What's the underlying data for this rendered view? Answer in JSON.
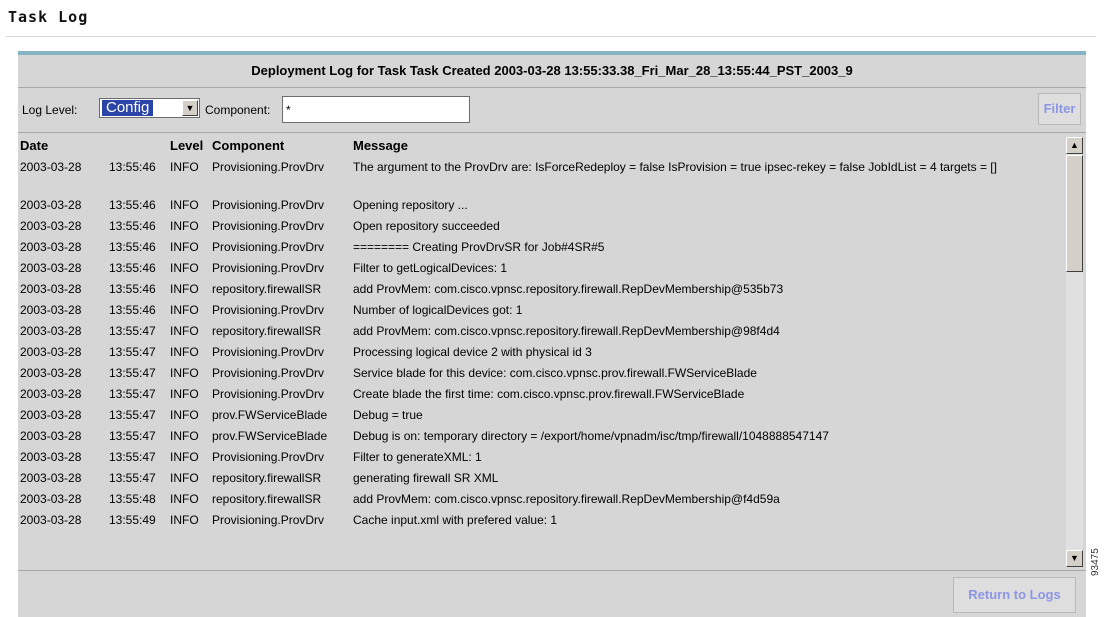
{
  "page": {
    "title": "Task Log"
  },
  "panel": {
    "header": "Deployment Log for Task Task Created 2003-03-28 13:55:33.38_Fri_Mar_28_13:55:44_PST_2003_9"
  },
  "controls": {
    "log_level_label": "Log Level:",
    "log_level_value": "Config",
    "component_label": "Component:",
    "component_value": "*",
    "filter_label": "Filter"
  },
  "table": {
    "columns": [
      "Date",
      "Level",
      "Component",
      "Message"
    ],
    "rows": [
      {
        "date": "2003-03-28",
        "time": "13:55:46",
        "level": "INFO",
        "component": "Provisioning.ProvDrv",
        "message": "The argument to the ProvDrv are: IsForceRedeploy = false IsProvision = true ipsec-rekey = false JobIdList = 4 targets = []"
      },
      {
        "date": "2003-03-28",
        "time": "13:55:46",
        "level": "INFO",
        "component": "Provisioning.ProvDrv",
        "message": "Opening repository ..."
      },
      {
        "date": "2003-03-28",
        "time": "13:55:46",
        "level": "INFO",
        "component": "Provisioning.ProvDrv",
        "message": "Open repository succeeded"
      },
      {
        "date": "2003-03-28",
        "time": "13:55:46",
        "level": "INFO",
        "component": "Provisioning.ProvDrv",
        "message": "======== Creating ProvDrvSR for Job#4SR#5"
      },
      {
        "date": "2003-03-28",
        "time": "13:55:46",
        "level": "INFO",
        "component": "Provisioning.ProvDrv",
        "message": "Filter to getLogicalDevices: 1"
      },
      {
        "date": "2003-03-28",
        "time": "13:55:46",
        "level": "INFO",
        "component": "repository.firewallSR",
        "message": "add ProvMem: com.cisco.vpnsc.repository.firewall.RepDevMembership@535b73"
      },
      {
        "date": "2003-03-28",
        "time": "13:55:46",
        "level": "INFO",
        "component": "Provisioning.ProvDrv",
        "message": "Number of logicalDevices got: 1"
      },
      {
        "date": "2003-03-28",
        "time": "13:55:47",
        "level": "INFO",
        "component": "repository.firewallSR",
        "message": "add ProvMem: com.cisco.vpnsc.repository.firewall.RepDevMembership@98f4d4"
      },
      {
        "date": "2003-03-28",
        "time": "13:55:47",
        "level": "INFO",
        "component": "Provisioning.ProvDrv",
        "message": "Processing logical device 2 with physical id 3"
      },
      {
        "date": "2003-03-28",
        "time": "13:55:47",
        "level": "INFO",
        "component": "Provisioning.ProvDrv",
        "message": "Service blade for this device: com.cisco.vpnsc.prov.firewall.FWServiceBlade"
      },
      {
        "date": "2003-03-28",
        "time": "13:55:47",
        "level": "INFO",
        "component": "Provisioning.ProvDrv",
        "message": "Create blade the first time: com.cisco.vpnsc.prov.firewall.FWServiceBlade"
      },
      {
        "date": "2003-03-28",
        "time": "13:55:47",
        "level": "INFO",
        "component": "prov.FWServiceBlade",
        "message": "Debug = true"
      },
      {
        "date": "2003-03-28",
        "time": "13:55:47",
        "level": "INFO",
        "component": "prov.FWServiceBlade",
        "message": "Debug is on: temporary directory = /export/home/vpnadm/isc/tmp/firewall/1048888547147"
      },
      {
        "date": "2003-03-28",
        "time": "13:55:47",
        "level": "INFO",
        "component": "Provisioning.ProvDrv",
        "message": "Filter to generateXML: 1"
      },
      {
        "date": "2003-03-28",
        "time": "13:55:47",
        "level": "INFO",
        "component": "repository.firewallSR",
        "message": "generating firewall SR XML"
      },
      {
        "date": "2003-03-28",
        "time": "13:55:48",
        "level": "INFO",
        "component": "repository.firewallSR",
        "message": "add ProvMem: com.cisco.vpnsc.repository.firewall.RepDevMembership@f4d59a"
      },
      {
        "date": "2003-03-28",
        "time": "13:55:49",
        "level": "INFO",
        "component": "Provisioning.ProvDrv",
        "message": "Cache input.xml with prefered value: 1"
      }
    ]
  },
  "footer": {
    "return_label": "Return to Logs"
  },
  "figure_id": "93475",
  "icons": {
    "dropdown": "chevron-down-icon",
    "scroll_up": "arrow-up-icon",
    "scroll_down": "arrow-down-icon"
  },
  "colors": {
    "panel_bg": "#d6d6d6",
    "accent_bar": "#86b4c2",
    "button_text": "#8c96e4",
    "selection": "#2b44a8"
  }
}
